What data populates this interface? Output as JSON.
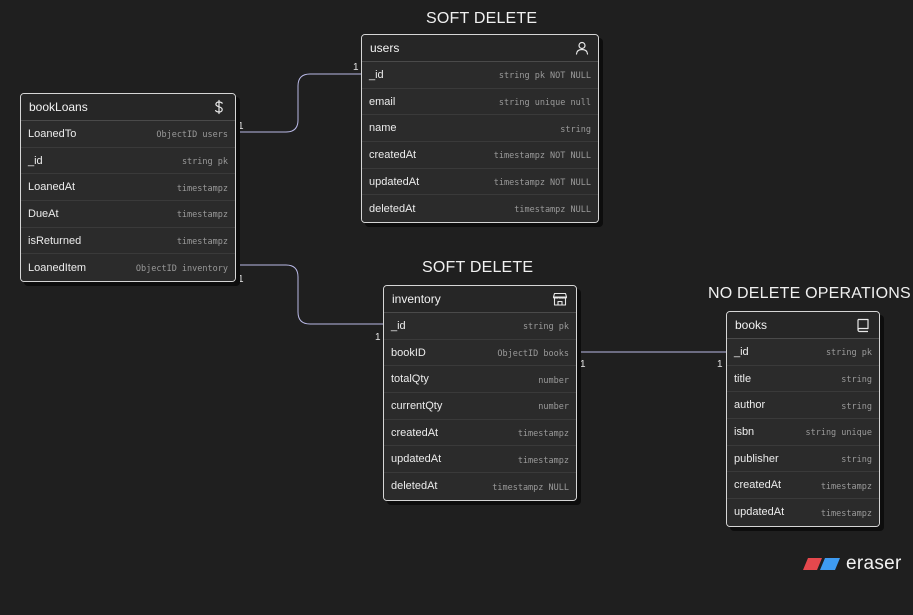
{
  "labels": {
    "users_group": "SOFT DELETE",
    "inventory_group": "SOFT DELETE",
    "books_group": "NO DELETE OPERATIONS"
  },
  "tables": {
    "bookLoans": {
      "title": "bookLoans",
      "icon": "dollar-icon",
      "fields": [
        {
          "name": "LoanedTo",
          "type": "ObjectID users"
        },
        {
          "name": "_id",
          "type": "string pk"
        },
        {
          "name": "LoanedAt",
          "type": "timestampz"
        },
        {
          "name": "DueAt",
          "type": "timestampz"
        },
        {
          "name": "isReturned",
          "type": "timestampz"
        },
        {
          "name": "LoanedItem",
          "type": "ObjectID inventory"
        }
      ]
    },
    "users": {
      "title": "users",
      "icon": "user-icon",
      "fields": [
        {
          "name": "_id",
          "type": "string pk NOT NULL"
        },
        {
          "name": "email",
          "type": "string unique null"
        },
        {
          "name": "name",
          "type": "string"
        },
        {
          "name": "createdAt",
          "type": "timestampz NOT NULL"
        },
        {
          "name": "updatedAt",
          "type": "timestampz NOT NULL"
        },
        {
          "name": "deletedAt",
          "type": "timestampz NULL"
        }
      ]
    },
    "inventory": {
      "title": "inventory",
      "icon": "store-icon",
      "fields": [
        {
          "name": "_id",
          "type": "string pk"
        },
        {
          "name": "bookID",
          "type": "ObjectID books"
        },
        {
          "name": "totalQty",
          "type": "number"
        },
        {
          "name": "currentQty",
          "type": "number"
        },
        {
          "name": "createdAt",
          "type": "timestampz"
        },
        {
          "name": "updatedAt",
          "type": "timestampz"
        },
        {
          "name": "deletedAt",
          "type": "timestampz NULL"
        }
      ]
    },
    "books": {
      "title": "books",
      "icon": "book-icon",
      "fields": [
        {
          "name": "_id",
          "type": "string pk"
        },
        {
          "name": "title",
          "type": "string"
        },
        {
          "name": "author",
          "type": "string"
        },
        {
          "name": "isbn",
          "type": "string unique"
        },
        {
          "name": "publisher",
          "type": "string"
        },
        {
          "name": "createdAt",
          "type": "timestampz"
        },
        {
          "name": "updatedAt",
          "type": "timestampz"
        }
      ]
    }
  },
  "cardinality": {
    "loanedto_bookloans": "1",
    "loanedto_users": "1",
    "loaneditem_bookloans": "1",
    "loaneditem_inventory": "1",
    "bookid_inventory": "1",
    "bookid_books": "1"
  },
  "colors": {
    "background": "#1f1f1f",
    "connector": "#b9b9e6",
    "brand_red": "#e5484d",
    "brand_blue": "#3e9bf2"
  },
  "brand": {
    "text": "eraser"
  }
}
